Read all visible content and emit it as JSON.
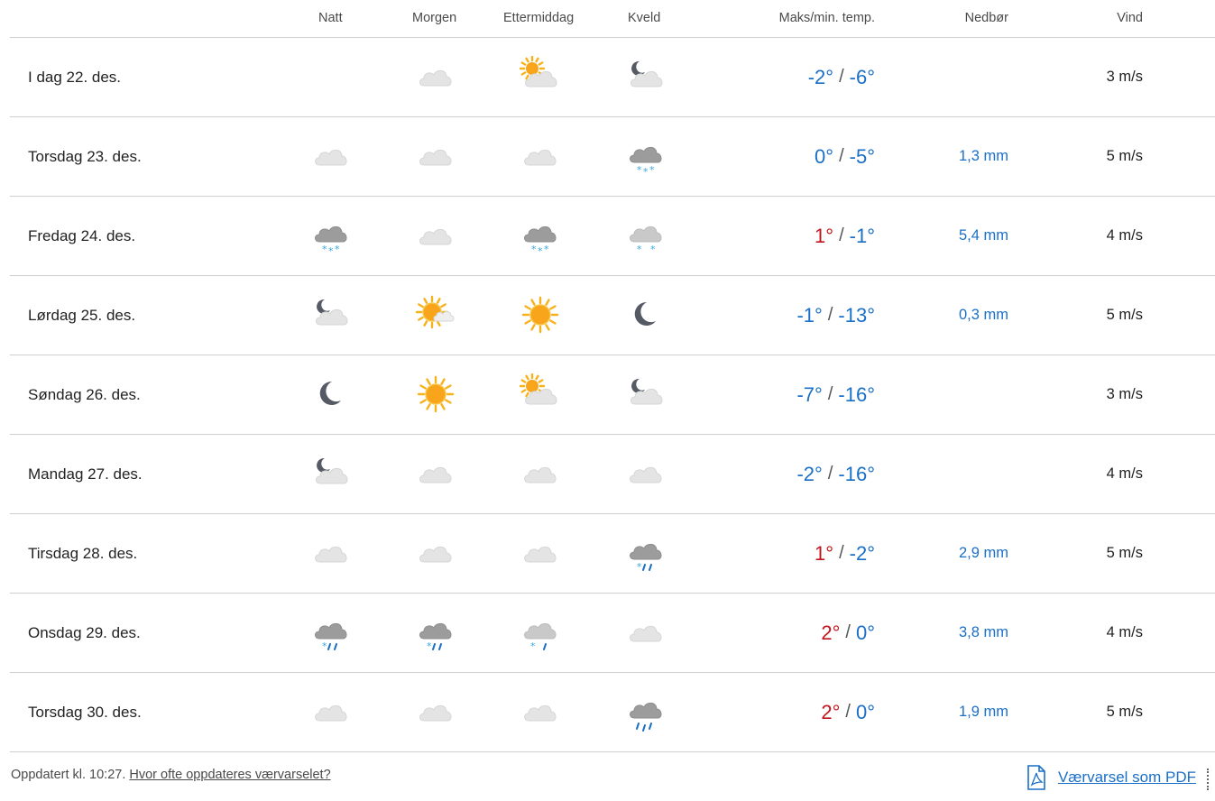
{
  "headers": {
    "natt": "Natt",
    "morgen": "Morgen",
    "ettermiddag": "Ettermiddag",
    "kveld": "Kveld",
    "temp": "Maks/min. temp.",
    "precip": "Nedbør",
    "wind": "Vind"
  },
  "rows": [
    {
      "day": "I dag 22. des.",
      "icons": [
        "none",
        "cloud-light-icon",
        "sun-cloud-icon",
        "moon-cloud-icon"
      ],
      "max": "-2°",
      "max_kind": "cold",
      "sep": "/",
      "min": "-6°",
      "precip": "",
      "wind": "3 m/s"
    },
    {
      "day": "Torsdag 23. des.",
      "icons": [
        "cloud-light-icon",
        "cloud-light-icon",
        "cloud-light-icon",
        "cloud-snow-heavy-icon"
      ],
      "max": "0°",
      "max_kind": "cold",
      "sep": "/",
      "min": "-5°",
      "precip": "1,3 mm",
      "wind": "5 m/s"
    },
    {
      "day": "Fredag 24. des.",
      "icons": [
        "cloud-snow-heavy-icon",
        "cloud-light-icon",
        "cloud-snow-heavy-icon",
        "cloud-snow-light-icon"
      ],
      "max": "1°",
      "max_kind": "warm",
      "sep": "/",
      "min": "-1°",
      "precip": "5,4 mm",
      "wind": "4 m/s"
    },
    {
      "day": "Lørdag 25. des.",
      "icons": [
        "moon-cloud-icon",
        "sun-partly-cloud-icon",
        "sun-icon",
        "moon-icon"
      ],
      "max": "-1°",
      "max_kind": "cold",
      "sep": "/",
      "min": "-13°",
      "precip": "0,3 mm",
      "wind": "5 m/s"
    },
    {
      "day": "Søndag 26. des.",
      "icons": [
        "moon-icon",
        "sun-icon",
        "sun-cloud-icon",
        "moon-cloud-icon"
      ],
      "max": "-7°",
      "max_kind": "cold",
      "sep": "/",
      "min": "-16°",
      "precip": "",
      "wind": "3 m/s"
    },
    {
      "day": "Mandag 27. des.",
      "icons": [
        "moon-cloud-icon",
        "cloud-light-icon",
        "cloud-light-icon",
        "cloud-light-icon"
      ],
      "max": "-2°",
      "max_kind": "cold",
      "sep": "/",
      "min": "-16°",
      "precip": "",
      "wind": "4 m/s"
    },
    {
      "day": "Tirsdag 28. des.",
      "icons": [
        "cloud-light-icon",
        "cloud-light-icon",
        "cloud-light-icon",
        "cloud-sleet-heavy-icon"
      ],
      "max": "1°",
      "max_kind": "warm",
      "sep": "/",
      "min": "-2°",
      "precip": "2,9 mm",
      "wind": "5 m/s"
    },
    {
      "day": "Onsdag 29. des.",
      "icons": [
        "cloud-sleet-heavy-icon",
        "cloud-sleet-heavy-icon",
        "cloud-sleet-light-icon",
        "cloud-light-icon"
      ],
      "max": "2°",
      "max_kind": "warm",
      "sep": "/",
      "min": "0°",
      "min_kind": "cold",
      "precip": "3,8 mm",
      "wind": "4 m/s"
    },
    {
      "day": "Torsdag 30. des.",
      "icons": [
        "cloud-light-icon",
        "cloud-light-icon",
        "cloud-light-icon",
        "cloud-rain-heavy-icon"
      ],
      "max": "2°",
      "max_kind": "warm",
      "sep": "/",
      "min": "0°",
      "precip": "1,9 mm",
      "wind": "5 m/s"
    }
  ],
  "footer": {
    "updated": "Oppdatert kl. 10:27.",
    "how_often_link": "Hvor ofte oppdateres værvarselet?",
    "pdf_link": "Værvarsel som PDF"
  },
  "colors": {
    "warm": "#c0151b",
    "cold": "#1a6fc7",
    "link": "#1a6fc7",
    "divider": "#cfcfcf"
  }
}
